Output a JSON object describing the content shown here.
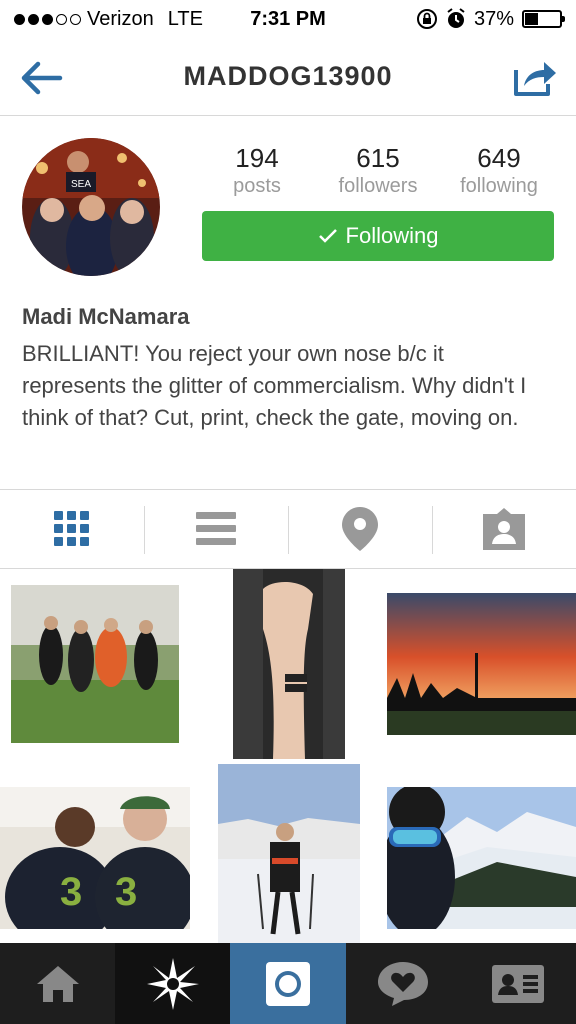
{
  "status_bar": {
    "carrier": "Verizon",
    "network": "LTE",
    "time": "7:31 PM",
    "battery_percent": "37%",
    "battery_level": 0.37,
    "signal_bars_filled": 3,
    "signal_bars_total": 5
  },
  "nav": {
    "title": "MADDOG13900",
    "back_icon": "back-arrow-icon",
    "share_icon": "share-icon"
  },
  "profile": {
    "stats": [
      {
        "count": "194",
        "label": "posts"
      },
      {
        "count": "615",
        "label": "followers"
      },
      {
        "count": "649",
        "label": "following"
      }
    ],
    "follow_button_label": "Following",
    "follow_button_color": "#3fb144",
    "name": "Madi McNamara",
    "bio": "BRILLIANT! You reject your own nose b/c it represents the glitter of commercialism. Why didn't I think of that? Cut, print, check the gate, moving on."
  },
  "view_tabs": [
    {
      "icon": "grid-icon",
      "active": true
    },
    {
      "icon": "list-icon",
      "active": false
    },
    {
      "icon": "location-pin-icon",
      "active": false
    },
    {
      "icon": "tagged-person-icon",
      "active": false
    }
  ],
  "colors": {
    "accent_blue": "#3a6f9e",
    "nav_blue": "#2e6da4",
    "follow_green": "#3fb144",
    "tab_bar_bg": "#1e1e1e"
  },
  "bottom_bar": [
    {
      "icon": "home-icon"
    },
    {
      "icon": "explore-star-icon"
    },
    {
      "icon": "camera-icon",
      "active": true
    },
    {
      "icon": "activity-heart-icon"
    },
    {
      "icon": "profile-card-icon"
    }
  ]
}
